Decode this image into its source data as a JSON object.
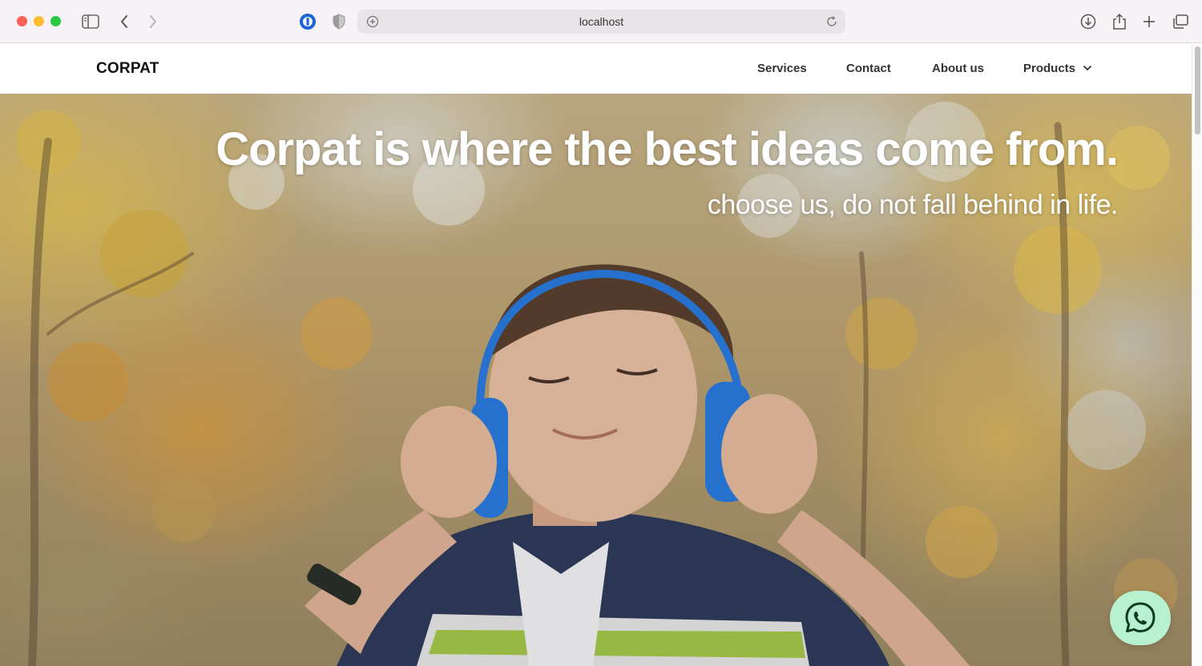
{
  "browser": {
    "url": "localhost",
    "icons": [
      "sidebar-icon",
      "back-icon",
      "forward-icon",
      "password-extension-icon",
      "privacy-shield-icon",
      "site-info-icon",
      "reload-icon",
      "download-icon",
      "share-icon",
      "new-tab-icon",
      "tab-overview-icon"
    ]
  },
  "navbar": {
    "brand": "CORPAT",
    "links": [
      "Services",
      "Contact",
      "About us",
      "Products"
    ]
  },
  "hero": {
    "title": "Corpat is where the best ideas come from.",
    "subtitle": "choose us, do not fall behind in life."
  },
  "colors": {
    "whatsapp_bg": "#b8f1cf",
    "text_dark": "#333333"
  }
}
